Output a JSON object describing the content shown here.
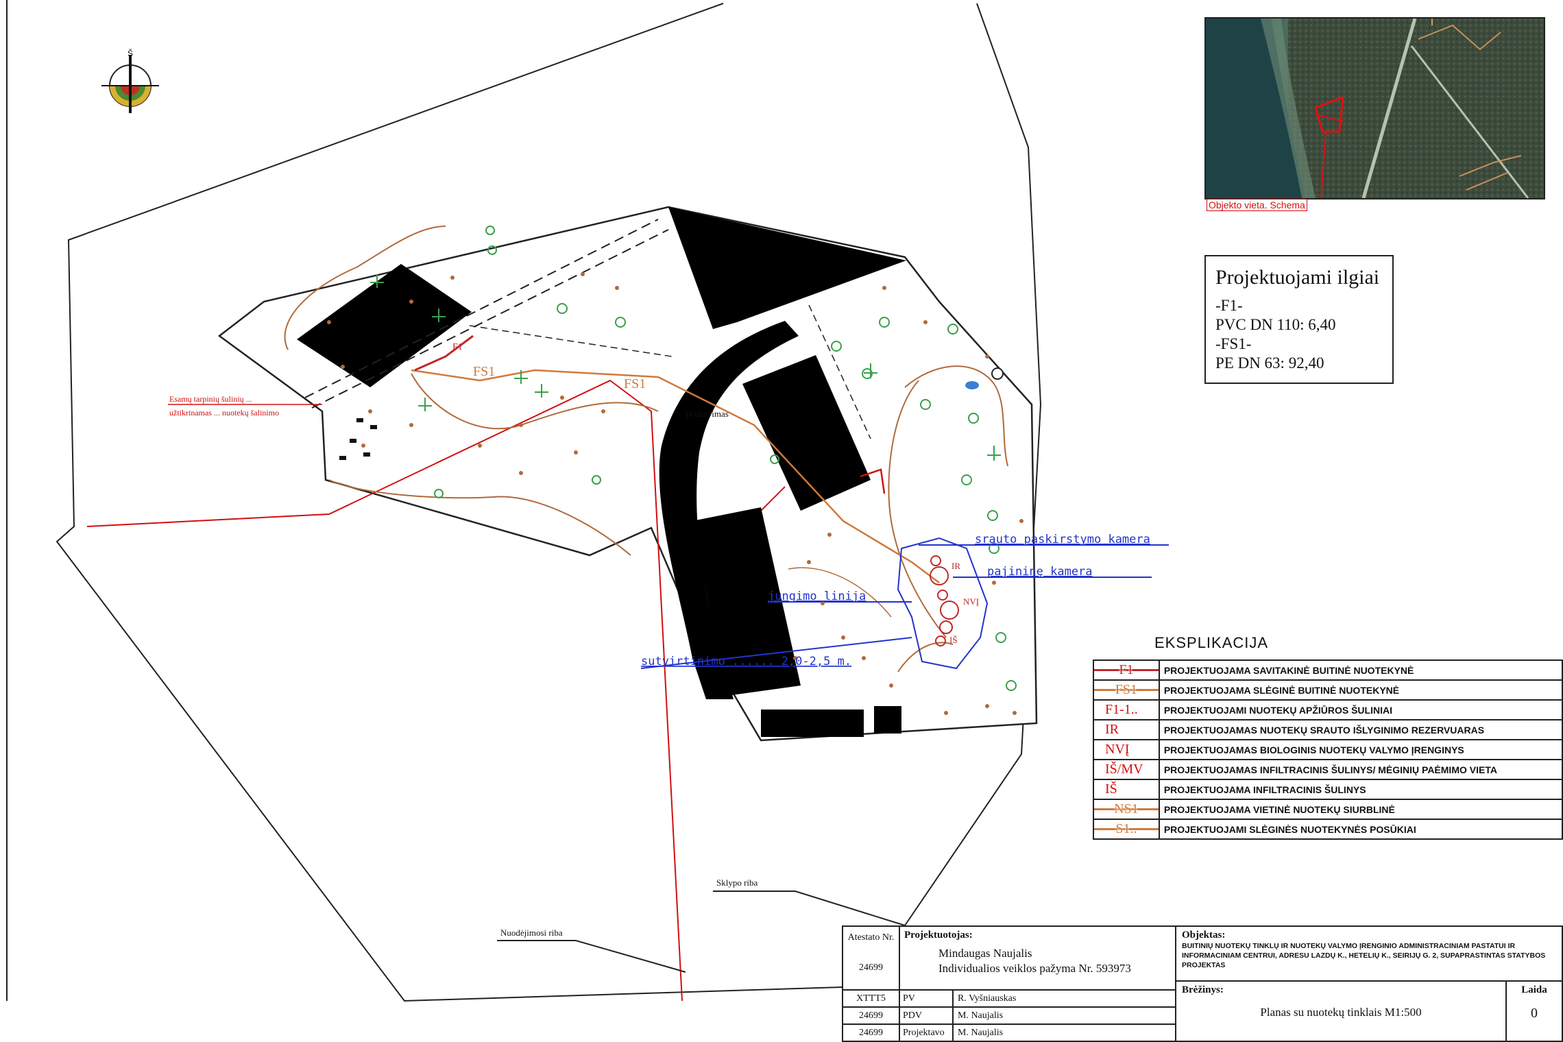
{
  "inset": {
    "caption": "Objekto vieta. Schema"
  },
  "lengths_box": {
    "title": "Projektuojami ilgiai",
    "lines": [
      "-F1-",
      "PVC DN 110: 6,40",
      "-FS1-",
      "PE DN 63: 92,40"
    ]
  },
  "map_labels": {
    "flow_chamber": "srauto paskirstymo kamera",
    "pump_chamber": "pajininę kamera",
    "connection_line": "jungimo linija",
    "soak_line": "sutvirtinimo ...... 2,0-2,5 m.",
    "existing_red_1": "Esamų tarpinių šulinių ...",
    "existing_red_2": "užtikrinamas ... nuotekų šalinimo",
    "entrance": "Įvažiavimas",
    "lot_boundary": "Sklypo riba",
    "lease_boundary": "Nuodėjimosi riba",
    "fs1_a": "FS1",
    "fs1_b": "FS1",
    "f1": "F1",
    "ir": "IR",
    "nvi": "NVĮ",
    "is": "IŠ"
  },
  "legend": {
    "title": "EKSPLIKACIJA",
    "colors": {
      "f1": "#c0282a",
      "fs1": "#d07a3a",
      "red": "#d01010"
    },
    "rows": [
      {
        "symbol": "F1",
        "desc": "PROJEKTUOJAMA SAVITAKINĖ BUITINĖ NUOTEKYNĖ",
        "style": "f1"
      },
      {
        "symbol": "FS1",
        "desc": "PROJEKTUOJAMA SLĖGINĖ BUITINĖ NUOTEKYNĖ",
        "style": "fs1"
      },
      {
        "symbol": "F1-1..",
        "desc": "PROJEKTUOJAMI NUOTEKŲ APŽIŪROS ŠULINIAI",
        "style": "red"
      },
      {
        "symbol": "IR",
        "desc": "PROJEKTUOJAMAS NUOTEKŲ SRAUTO IŠLYGINIMO REZERVUARAS",
        "style": "red"
      },
      {
        "symbol": "NVĮ",
        "desc": "PROJEKTUOJAMAS BIOLOGINIS NUOTEKŲ VALYMO ĮRENGINYS",
        "style": "red"
      },
      {
        "symbol": "IŠ/MV",
        "desc": "PROJEKTUOJAMAS INFILTRACINIS ŠULINYS/ MĖGINIŲ PAĖMIMO VIETA",
        "style": "red"
      },
      {
        "symbol": "IŠ",
        "desc": "PROJEKTUOJAMA INFILTRACINIS ŠULINYS",
        "style": "red"
      },
      {
        "symbol": "NS1",
        "desc": "PROJEKTUOJAMA VIETINĖ NUOTEKŲ SIURBLINĖ",
        "style": "fs1"
      },
      {
        "symbol": "S1..",
        "desc": "PROJEKTUOJAMI SLĖGINĖS NUOTEKYNĖS POSŪKIAI",
        "style": "fs1"
      }
    ]
  },
  "title_block": {
    "atestato_header": "Atestato Nr.",
    "atestato_no": "24699",
    "projektuotojas_label": "Projektuotojas:",
    "designer_name": "Mindaugas Naujalis",
    "designer_cert": "Individualios veiklos pažyma Nr. 593973",
    "objektas_label": "Objektas:",
    "objektas_text": "BUITINIŲ NUOTEKŲ TINKLŲ IR NUOTEKŲ VALYMO ĮRENGINIO ADMINISTRACINIAM PASTATUI IR INFORMACINIAM CENTRUI, ADRESU LAZDŲ K., HETELIŲ K., SEIRIJŲ G. 2, SUPAPRASTINTAS STATYBOS PROJEKTAS",
    "staff": [
      {
        "id": "XTTT5",
        "role": "PV",
        "name": "R. Vyšniauskas"
      },
      {
        "id": "24699",
        "role": "PDV",
        "name": "M. Naujalis"
      },
      {
        "id": "24699",
        "role": "Projektavo",
        "name": "M. Naujalis"
      }
    ],
    "breziniys_label": "Brėžinys:",
    "drawing_title": "Planas su nuotekų tinklais M1:500",
    "laida_label": "Laida",
    "laida_value": "0"
  }
}
